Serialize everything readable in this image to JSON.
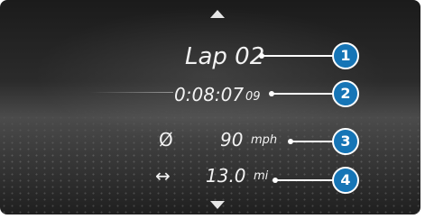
{
  "navigation": {
    "up_icon": "triangle-up-icon",
    "down_icon": "triangle-down-icon"
  },
  "lap": {
    "label": "Lap 02"
  },
  "time": {
    "main": "0:08:07",
    "fraction": "09"
  },
  "average_speed": {
    "icon": "Ø",
    "value": "90",
    "unit": "mph"
  },
  "distance": {
    "icon": "↔",
    "value": "13.0",
    "unit": "mi"
  },
  "callouts": [
    "1",
    "2",
    "3",
    "4"
  ],
  "colors": {
    "callout_fill": "#1675b6",
    "callout_border": "#ffffff",
    "text": "#f2f2f2"
  }
}
